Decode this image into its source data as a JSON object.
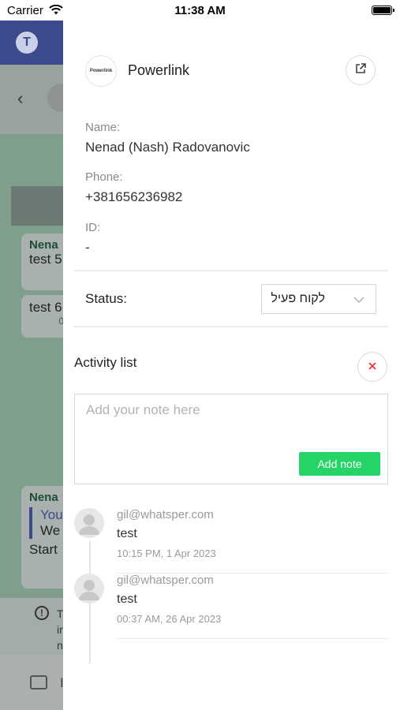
{
  "status_bar": {
    "carrier": "Carrier",
    "time": "11:38 AM"
  },
  "background_chat": {
    "app_logo_letter": "T",
    "messages": [
      {
        "sender": "Nena",
        "text": "test 5"
      },
      {
        "text": "test 6",
        "meta": "0"
      },
      {
        "sender": "Nena",
        "quote": "You",
        "line1": "We",
        "line2": "Start"
      }
    ],
    "info_text": [
      "T",
      "in",
      "n"
    ],
    "input_initial": "I"
  },
  "panel": {
    "brand_logo_text": "Powerlink",
    "brand_name": "Powerlink",
    "fields": {
      "name_label": "Name:",
      "name_value": "Nenad (Nash) Radovanovic",
      "phone_label": "Phone:",
      "phone_value": "+381656236982",
      "id_label": "ID:",
      "id_value": "-"
    },
    "status": {
      "label": "Status:",
      "selected": "לקוח פעיל"
    },
    "activity": {
      "title": "Activity list",
      "note_placeholder": "Add your note here",
      "add_note_label": "Add note",
      "items": [
        {
          "user": "gil@whatsper.com",
          "text": "test",
          "time": "10:15 PM, 1 Apr 2023"
        },
        {
          "user": "gil@whatsper.com",
          "text": "test",
          "time": "00:37 AM, 26 Apr 2023"
        }
      ]
    }
  },
  "colors": {
    "accent_green": "#25d366",
    "close_red": "#e53935",
    "top_bar": "#3d4a8e"
  },
  "icons": {
    "external_link": "external-link-icon",
    "close": "close-icon",
    "chevron": "chevron-down-icon",
    "avatar": "user-avatar-icon"
  }
}
